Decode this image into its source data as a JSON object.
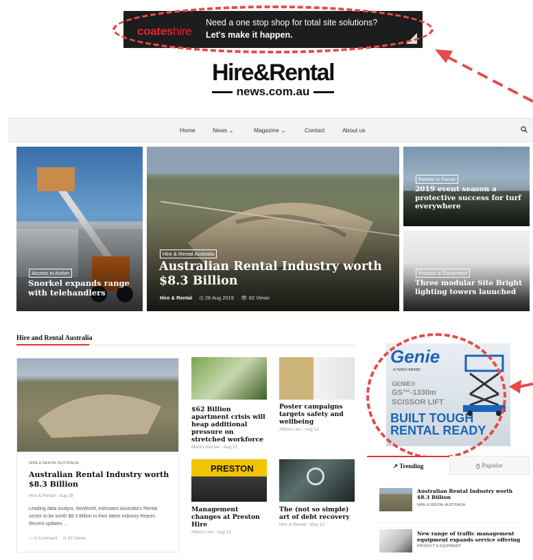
{
  "top_ad": {
    "brand_a": "coates",
    "brand_b": "hire",
    "line1": "Need a one stop shop for total site solutions?",
    "line2": "Let's make it happen."
  },
  "masthead": {
    "title": "Hire&Rental",
    "subtitle": "news.com.au"
  },
  "nav": {
    "items": [
      {
        "label": "Home"
      },
      {
        "label": "News ⌄"
      },
      {
        "label": "Magazine ⌄"
      },
      {
        "label": "Contact"
      },
      {
        "label": "About us"
      }
    ]
  },
  "hero": [
    {
      "tag": "Access In Action",
      "title": "Snorkel expands range with telehandlers"
    },
    {
      "tag": "Hire & Rental Australia",
      "title": "Australian Rental Industry worth $8.3 Billion",
      "author": "Hire & Rental",
      "date": "28 Aug 2019",
      "views": "82 Views"
    },
    {
      "tag": "Events In Focus",
      "title": "2019 event season a protective success for turf everywhere"
    },
    {
      "tag": "Product & Equipment",
      "title": "Three modular Site Bright lighting towers launched"
    }
  ],
  "section": {
    "title": "Hire and Rental Australia",
    "feature": {
      "category": "HIRE & RENTAL AUSTRALIA",
      "title": "Australian Rental Industry worth $8.3 Billion",
      "meta": "Hire & Rental - Aug 29",
      "excerpt": "Leading data analyst, IbisWorld, estimates Australia's Rental sector to be worth $8.3 Billion in their latest Industry Report. Recent updates ...",
      "comments": "0 Comment",
      "views": "82 Views"
    },
    "grid": [
      {
        "title": "$62 Billion apartment crisis will heap additional pressure on stretched workforce",
        "meta": "Martin Sinclair - Aug 22"
      },
      {
        "title": "Poster campaigns targets safety and wellbeing",
        "meta": "Allison Leo - Aug 12"
      },
      {
        "title": "Management changes at Preston Hire",
        "meta": "Allison Leo - Aug 12",
        "image_text": "PRESTON"
      },
      {
        "title": "The (not so simple) art of debt recovery",
        "meta": "Hire & Rental - May 12"
      }
    ]
  },
  "sidebar_ad": {
    "brand": "Genie",
    "sub": "A TEREX BRAND",
    "model1": "GENIE®",
    "model2": "GS™-1330m",
    "model3": "SCISSOR LIFT",
    "slogan1": "BUILT TOUGH",
    "slogan2": "RENTAL READY"
  },
  "tabs": {
    "trending": "Trending",
    "popular": "Popular"
  },
  "trending": [
    {
      "title": "Australian Rental Industry worth $8.3 Billion",
      "category": "HIRE & RENTAL AUSTRALIA"
    },
    {
      "title": "New range of traffic management equipment expands service offering",
      "category": "PRODUCT & EQUIPMENT"
    }
  ],
  "colors": {
    "accent": "#d33333",
    "annotation": "#e64b4b",
    "ad_bg": "#1b1d1f",
    "genie_blue": "#1c63b7"
  }
}
